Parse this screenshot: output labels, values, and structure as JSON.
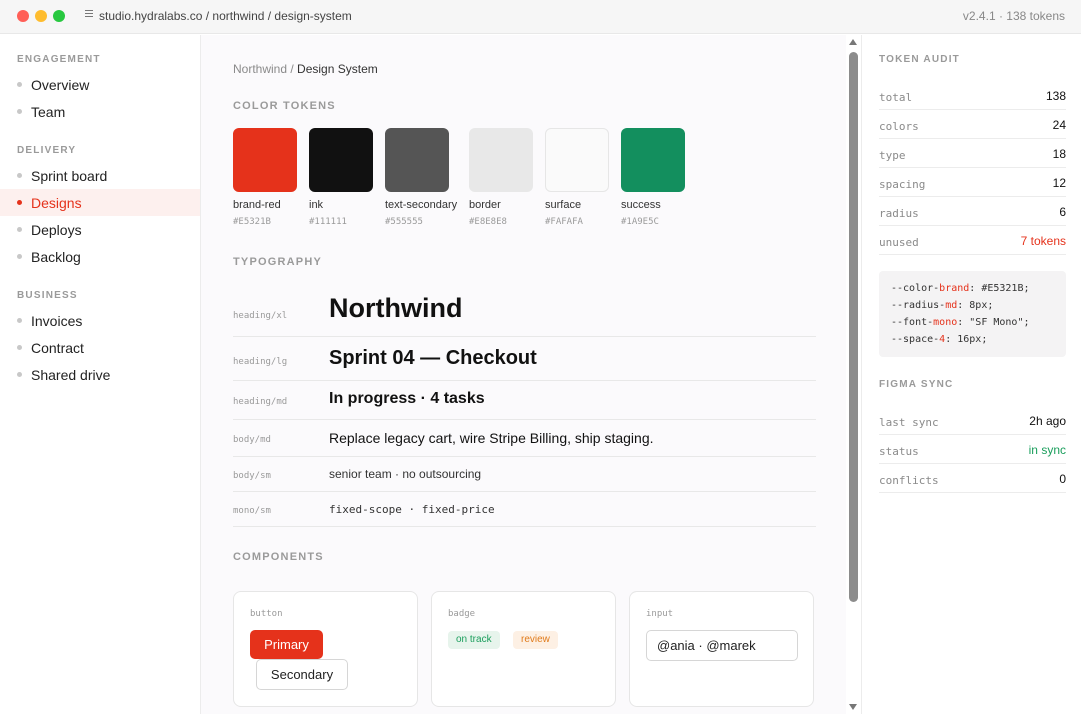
{
  "titlebar": {
    "url": "studio.hydralabs.co / northwind / design-system",
    "version": "v2.4.1 · 138 tokens"
  },
  "sidebar": {
    "sections": [
      {
        "title": "ENGAGEMENT",
        "items": [
          {
            "label": "Overview"
          },
          {
            "label": "Team"
          }
        ]
      },
      {
        "title": "DELIVERY",
        "items": [
          {
            "label": "Sprint board"
          },
          {
            "label": "Designs",
            "active": true
          },
          {
            "label": "Deploys"
          },
          {
            "label": "Backlog"
          }
        ]
      },
      {
        "title": "BUSINESS",
        "items": [
          {
            "label": "Invoices"
          },
          {
            "label": "Contract"
          },
          {
            "label": "Shared drive"
          }
        ]
      }
    ]
  },
  "main": {
    "breadcrumb": {
      "parent": "Northwind /",
      "current": "Design System"
    },
    "color_title": "COLOR TOKENS",
    "colors": [
      {
        "name": "brand-red",
        "hex": "#E5321B"
      },
      {
        "name": "ink",
        "hex": "#111111"
      },
      {
        "name": "text-secondary",
        "hex": "#555555"
      },
      {
        "name": "border",
        "hex": "#E8E8E8"
      },
      {
        "name": "surface",
        "hex": "#FAFAFA"
      },
      {
        "name": "success",
        "hex": "#1A9E5C"
      }
    ],
    "typography_title": "TYPOGRAPHY",
    "typography": [
      {
        "token": "heading/xl",
        "sample": "Northwind"
      },
      {
        "token": "heading/lg",
        "sample": "Sprint 04 — Checkout"
      },
      {
        "token": "heading/md",
        "sample": "In progress · 4 tasks"
      },
      {
        "token": "body/md",
        "sample": "Replace legacy cart, wire Stripe Billing, ship staging."
      },
      {
        "token": "body/sm",
        "sample": "senior team · no outsourcing"
      },
      {
        "token": "mono/sm",
        "sample": "fixed-scope · fixed-price"
      }
    ],
    "components_title": "COMPONENTS",
    "components": {
      "button": {
        "caption": "button",
        "primary": "Primary",
        "secondary": "Secondary"
      },
      "badge": {
        "caption": "badge",
        "on_track": "on track",
        "review": "review"
      },
      "input": {
        "caption": "input",
        "value": "@ania · @marek"
      }
    }
  },
  "panel": {
    "audit_title": "TOKEN AUDIT",
    "audit": [
      {
        "key": "total",
        "value": "138"
      },
      {
        "key": "colors",
        "value": "24"
      },
      {
        "key": "type",
        "value": "18"
      },
      {
        "key": "spacing",
        "value": "12"
      },
      {
        "key": "radius",
        "value": "6"
      },
      {
        "key": "unused",
        "value": "7 tokens"
      }
    ],
    "code": {
      "l1_pre": "--color-",
      "l1_hl": "brand",
      "l1_post": ": #E5321B;",
      "l2_pre": "--radius-",
      "l2_hl": "md",
      "l2_post": ": 8px;",
      "l3_pre": "--font-",
      "l3_hl": "mono",
      "l3_post": ": \"SF Mono\";",
      "l4_pre": "--space-",
      "l4_hl": "4",
      "l4_post": ": 16px;"
    },
    "figma_title": "FIGMA SYNC",
    "figma": [
      {
        "key": "last sync",
        "value": "2h ago"
      },
      {
        "key": "status",
        "value": "in sync"
      },
      {
        "key": "conflicts",
        "value": "0"
      }
    ]
  },
  "colors": {
    "accent": "#E5321B",
    "success": "#1A9E5C",
    "warning": "#E07A1A"
  },
  "icons": {
    "url": "menu-lines-icon",
    "scroll_up": "chevron-up-icon",
    "scroll_down": "chevron-down-icon"
  }
}
